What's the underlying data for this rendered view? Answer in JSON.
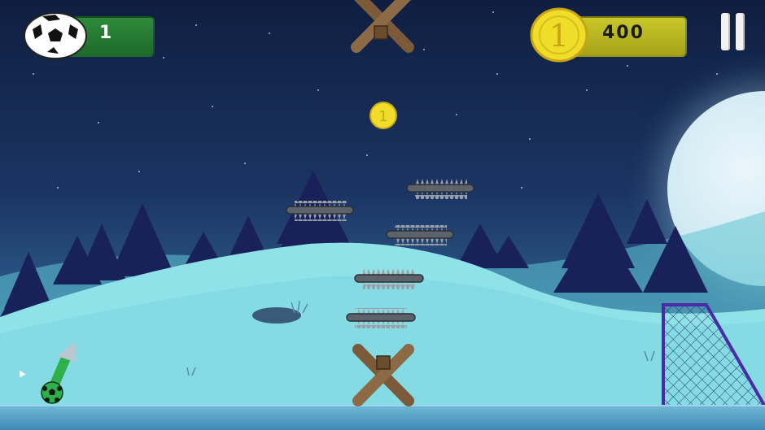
{
  "hud": {
    "balls_remaining": "1",
    "coins": "400"
  },
  "colors": {
    "ball_pill": "#2d8a3a",
    "coin_pill": "#c9c72a",
    "coin_gold": "#f0dd2a",
    "aim_arrow": "#2fb04a",
    "goal_frame": "#4b2aa8",
    "snow_hill": "#8fe3e8",
    "tree": "#18215a"
  },
  "icons": {
    "ball": "soccer-ball-icon",
    "coin": "gold-coin-icon",
    "pause": "pause-icon"
  },
  "collectibles": {
    "coin_value_glyph": "1"
  }
}
